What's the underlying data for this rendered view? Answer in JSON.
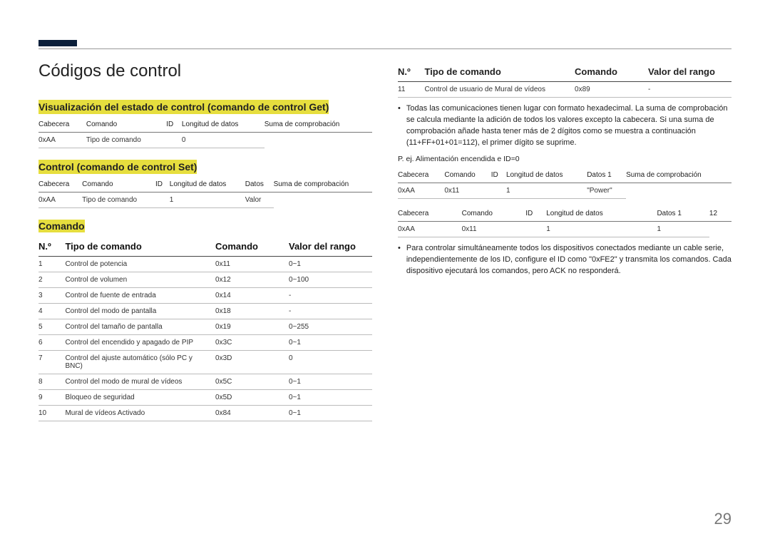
{
  "page_number": "29",
  "main_title": "Códigos de control",
  "section_get": {
    "heading": "Visualización del estado de control (comando de control Get)",
    "headers": [
      "Cabecera",
      "Comando",
      "ID",
      "Longitud de datos",
      "Suma de comprobación"
    ],
    "row": [
      "0xAA",
      "Tipo de comando",
      "",
      "0",
      ""
    ]
  },
  "section_set": {
    "heading": "Control (comando de control Set)",
    "headers": [
      "Cabecera",
      "Comando",
      "ID",
      "Longitud de datos",
      "Datos",
      "Suma de comprobación"
    ],
    "row": [
      "0xAA",
      "Tipo de comando",
      "",
      "1",
      "Valor",
      ""
    ]
  },
  "section_comando": {
    "heading": "Comando",
    "headers": [
      "N.º",
      "Tipo de comando",
      "Comando",
      "Valor del rango"
    ],
    "rows": [
      [
        "1",
        "Control de potencia",
        "0x11",
        "0~1"
      ],
      [
        "2",
        "Control de volumen",
        "0x12",
        "0~100"
      ],
      [
        "3",
        "Control de fuente de entrada",
        "0x14",
        "-"
      ],
      [
        "4",
        "Control del modo de pantalla",
        "0x18",
        "-"
      ],
      [
        "5",
        "Control del tamaño de pantalla",
        "0x19",
        "0~255"
      ],
      [
        "6",
        "Control del encendido y apagado de PIP",
        "0x3C",
        "0~1"
      ],
      [
        "7",
        "Control del ajuste automático (sólo PC y BNC)",
        "0x3D",
        "0"
      ],
      [
        "8",
        "Control del modo de mural de vídeos",
        "0x5C",
        "0~1"
      ],
      [
        "9",
        "Bloqueo de seguridad",
        "0x5D",
        "0~1"
      ],
      [
        "10",
        "Mural de vídeos Activado",
        "0x84",
        "0~1"
      ]
    ]
  },
  "right": {
    "top_headers": [
      "N.º",
      "Tipo de comando",
      "Comando",
      "Valor del rango"
    ],
    "top_row": [
      "11",
      "Control de usuario de Mural de vídeos",
      "0x89",
      "-"
    ],
    "bullet1": "Todas las comunicaciones tienen lugar con formato hexadecimal. La suma de comprobación se calcula mediante la adición de todos los valores excepto la cabecera. Si una suma de comprobación añade hasta tener más de 2 dígitos como se muestra a continuación (11+FF+01+01=112), el primer dígito se suprime.",
    "example_label": "P. ej. Alimentación encendida e ID=0",
    "example_table1": {
      "headers": [
        "Cabecera",
        "Comando",
        "ID",
        "Longitud de datos",
        "Datos 1",
        "Suma de comprobación"
      ],
      "row": [
        "0xAA",
        "0x11",
        "",
        "1",
        "\"Power\"",
        ""
      ]
    },
    "example_table2": {
      "headers": [
        "Cabecera",
        "Comando",
        "ID",
        "Longitud de datos",
        "Datos 1",
        "12"
      ],
      "row": [
        "0xAA",
        "0x11",
        "",
        "1",
        "1",
        ""
      ]
    },
    "bullet2": "Para controlar simultáneamente todos los dispositivos conectados mediante un cable serie, independientemente de los ID, configure el ID como \"0xFE2\" y transmita los comandos. Cada dispositivo ejecutará los comandos, pero ACK no responderá."
  }
}
